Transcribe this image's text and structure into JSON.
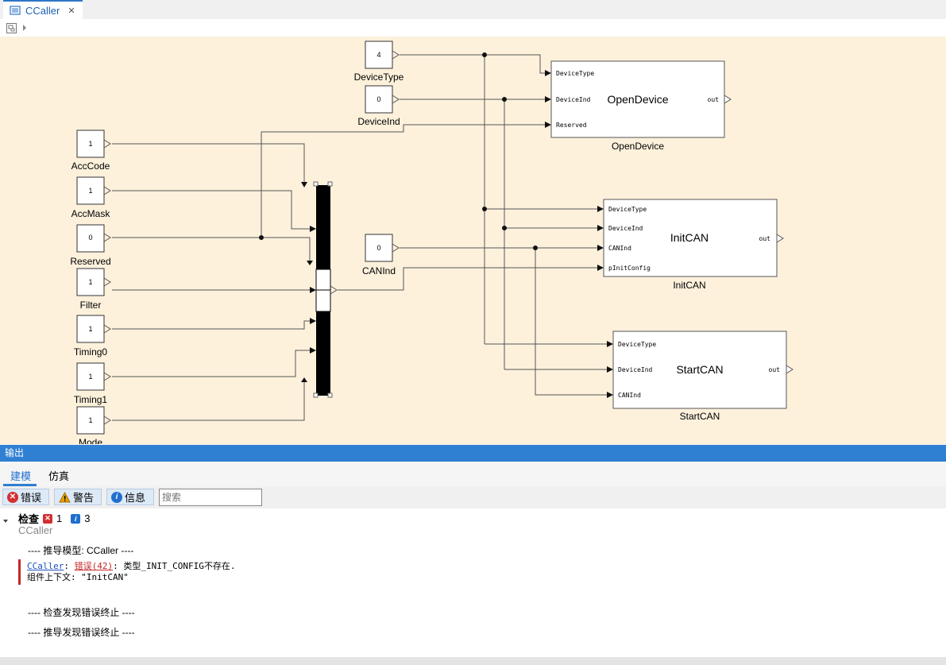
{
  "tab": {
    "title": "CCaller",
    "close": "✕"
  },
  "blocks": {
    "device_type": {
      "value": "4",
      "name": "DeviceType"
    },
    "device_ind": {
      "value": "0",
      "name": "DeviceInd"
    },
    "acc_code": {
      "value": "1",
      "name": "AccCode"
    },
    "acc_mask": {
      "value": "1",
      "name": "AccMask"
    },
    "reserved": {
      "value": "0",
      "name": "Reserved"
    },
    "filter": {
      "value": "1",
      "name": "Filter"
    },
    "timing0": {
      "value": "1",
      "name": "Timing0"
    },
    "timing1": {
      "value": "1",
      "name": "Timing1"
    },
    "mode": {
      "value": "1",
      "name": "Mode"
    },
    "can_ind": {
      "value": "0",
      "name": "CANInd"
    },
    "open_device": {
      "title": "OpenDevice",
      "label": "OpenDevice",
      "ports": [
        "DeviceType",
        "DeviceInd",
        "Reserved"
      ],
      "out": "out"
    },
    "init_can": {
      "title": "InitCAN",
      "label": "InitCAN",
      "ports": [
        "DeviceType",
        "DeviceInd",
        "CANInd",
        "pInitConfig"
      ],
      "out": "out"
    },
    "start_can": {
      "title": "StartCAN",
      "label": "StartCAN",
      "ports": [
        "DeviceType",
        "DeviceInd",
        "CANInd"
      ],
      "out": "out"
    }
  },
  "output": {
    "title": "输出",
    "tabs": [
      "建模",
      "仿真"
    ],
    "filters": {
      "error": "错误",
      "warning": "警告",
      "info": "信息"
    },
    "search_placeholder": "搜索",
    "check_label": "检查",
    "error_count": "1",
    "info_count": "3",
    "model_name": "CCaller",
    "line_derive": "---- 推导模型: CCaller ----",
    "err_link": "CCaller",
    "err_sep": ": ",
    "err_code": "错误(42)",
    "err_msg": ": 类型_INIT_CONFIG不存在.",
    "err_context": "组件上下文: \"InitCAN\"",
    "line_check_end": "---- 检查发现错误终止 ----",
    "line_derive_end": "---- 推导发现错误终止 ----"
  },
  "colors": {
    "accent": "#2f7fd2",
    "canvas_bg": "#fdf1dc",
    "error": "#c62828"
  }
}
